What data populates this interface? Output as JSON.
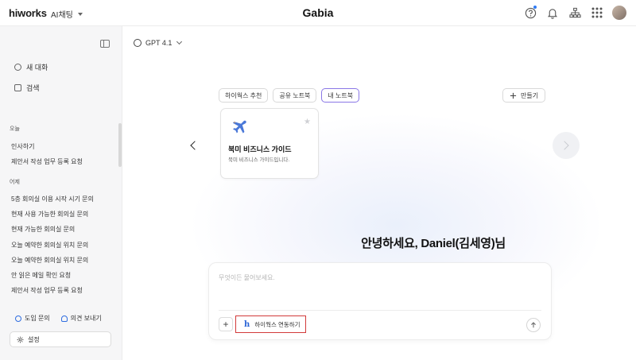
{
  "header": {
    "logo": "hiworks",
    "app_select": "AI채팅",
    "brand": "Gabia"
  },
  "sidebar": {
    "nav": [
      {
        "label": "새 대화"
      },
      {
        "label": "검색"
      }
    ],
    "sections": [
      {
        "label": "오늘",
        "items": [
          "인사하기",
          "제안서 작성 업무 등록 요청"
        ]
      },
      {
        "label": "어제",
        "items": [
          "5층 회의실 이용 시작 시기 문의",
          "현재 사용 가능한 회의실 문의",
          "현재 가능한 회의실 문의",
          "오늘 예약한 회의실 위치 문의",
          "오늘 예약한 회의실 위치 문의",
          "안 읽은 메일 확인 요청",
          "제안서 작성 업무 등록 요청"
        ]
      }
    ],
    "footer_links": {
      "inquiry": "도입 문의",
      "feedback": "의견 보내기"
    },
    "settings": "설정"
  },
  "main": {
    "model": "GPT 4.1",
    "tabs": [
      {
        "label": "하이웍스 추천"
      },
      {
        "label": "공유 노트북"
      },
      {
        "label": "내 노트북"
      }
    ],
    "make_button": "만들기",
    "card": {
      "title": "북미 비즈니스 가이드",
      "desc": "북미 비즈니스 가이드입니다."
    },
    "greeting": "안녕하세요, Daniel(김세영)님",
    "composer": {
      "placeholder": "무엇이든 물어보세요.",
      "hiworks_link": "하이웍스 연동하기",
      "hiworks_letter": "h"
    }
  },
  "colors": {
    "accent": "#2f6de0",
    "active_tab_border": "#8a77e6",
    "highlight_box": "#d23a3a"
  }
}
